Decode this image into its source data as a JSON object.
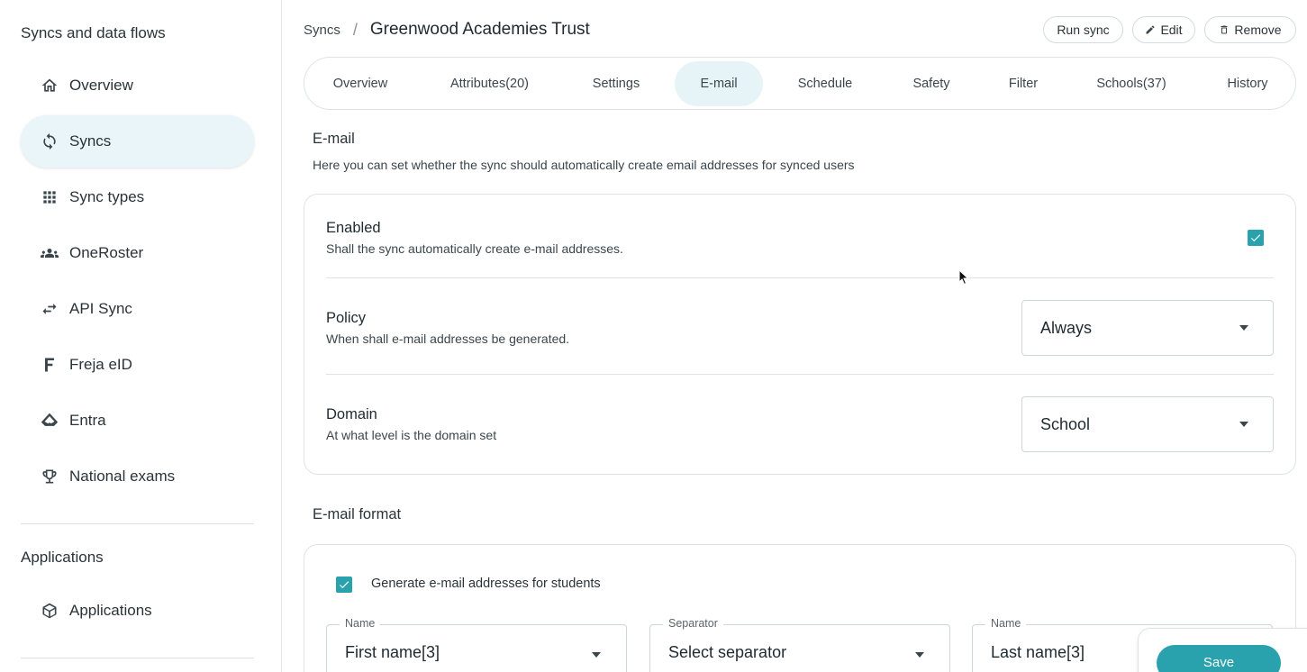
{
  "sidebar": {
    "heading": "Syncs and data flows",
    "items": [
      {
        "label": "Overview",
        "icon": "home-icon"
      },
      {
        "label": "Syncs",
        "icon": "sync-icon",
        "active": true
      },
      {
        "label": "Sync types",
        "icon": "grid-icon"
      },
      {
        "label": "OneRoster",
        "icon": "people-icon"
      },
      {
        "label": "API Sync",
        "icon": "swap-arrows-icon"
      },
      {
        "label": "Freja eID",
        "icon": "freja-f-icon"
      },
      {
        "label": "Entra",
        "icon": "entra-icon"
      },
      {
        "label": "National exams",
        "icon": "trophy-icon"
      }
    ],
    "apps_heading": "Applications",
    "apps_items": [
      {
        "label": "Applications",
        "icon": "cube-icon"
      }
    ]
  },
  "header": {
    "breadcrumb_root": "Syncs",
    "breadcrumb_sep": "/",
    "title": "Greenwood Academies Trust",
    "run_sync_label": "Run sync",
    "edit_label": "Edit",
    "remove_label": "Remove"
  },
  "tabs": [
    {
      "label": "Overview"
    },
    {
      "label": "Attributes(20)"
    },
    {
      "label": "Settings"
    },
    {
      "label": "E-mail",
      "active": true
    },
    {
      "label": "Schedule"
    },
    {
      "label": "Safety"
    },
    {
      "label": "Filter"
    },
    {
      "label": "Schools(37)"
    },
    {
      "label": "History"
    }
  ],
  "email_section": {
    "title": "E-mail",
    "description": "Here you can set whether the sync should automatically create email addresses for synced users",
    "enabled": {
      "title": "Enabled",
      "description": "Shall the sync automatically create e-mail addresses.",
      "checked": true
    },
    "policy": {
      "title": "Policy",
      "description": "When shall e-mail addresses be generated.",
      "value": "Always"
    },
    "domain": {
      "title": "Domain",
      "description": "At what level is the domain set",
      "value": "School"
    }
  },
  "format_section": {
    "title": "E-mail format",
    "generate_students_label": "Generate e-mail addresses for students",
    "generate_students_checked": true,
    "fields": [
      {
        "label": "Name",
        "value": "First name[3]"
      },
      {
        "label": "Separator",
        "value": "Select separator"
      },
      {
        "label": "Name",
        "value": "Last name[3]"
      }
    ]
  },
  "save_label": "Save",
  "colors": {
    "accent": "#2aa2ae",
    "active_bg": "#e9f5f8",
    "border": "#dfe3e6"
  }
}
